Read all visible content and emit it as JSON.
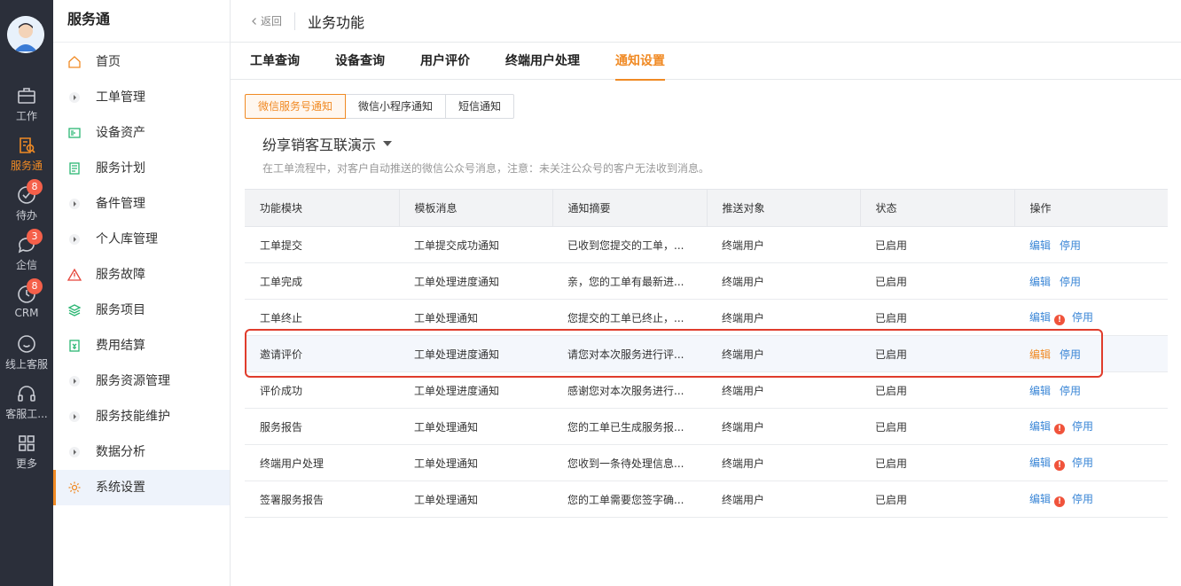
{
  "rail": {
    "items": [
      {
        "label": "工作",
        "icon": "briefcase-icon",
        "badge": ""
      },
      {
        "label": "服务通",
        "icon": "service-icon",
        "badge": ""
      },
      {
        "label": "待办",
        "icon": "check-circle-icon",
        "badge": "8"
      },
      {
        "label": "企信",
        "icon": "chat-icon",
        "badge": "3"
      },
      {
        "label": "CRM",
        "icon": "clock-icon",
        "badge": "8"
      },
      {
        "label": "线上客服",
        "icon": "smile-chat-icon",
        "badge": ""
      },
      {
        "label": "客服工...",
        "icon": "headset-icon",
        "badge": ""
      },
      {
        "label": "更多",
        "icon": "grid-icon",
        "badge": ""
      }
    ]
  },
  "sidebar": {
    "title": "服务通",
    "items": [
      {
        "label": "首页",
        "icon": "home-icon"
      },
      {
        "label": "工单管理",
        "icon": "caret-icon"
      },
      {
        "label": "设备资产",
        "icon": "device-icon"
      },
      {
        "label": "服务计划",
        "icon": "plan-icon"
      },
      {
        "label": "备件管理",
        "icon": "caret-icon"
      },
      {
        "label": "个人库管理",
        "icon": "caret-icon"
      },
      {
        "label": "服务故障",
        "icon": "warning-icon"
      },
      {
        "label": "服务项目",
        "icon": "layers-icon"
      },
      {
        "label": "费用结算",
        "icon": "bill-icon"
      },
      {
        "label": "服务资源管理",
        "icon": "caret-icon"
      },
      {
        "label": "服务技能维护",
        "icon": "caret-icon"
      },
      {
        "label": "数据分析",
        "icon": "caret-icon"
      },
      {
        "label": "系统设置",
        "icon": "gear-icon"
      }
    ]
  },
  "header": {
    "back_label": "返回",
    "title": "业务功能"
  },
  "tabs": [
    "工单查询",
    "设备查询",
    "用户评价",
    "终端用户处理",
    "通知设置"
  ],
  "segments": [
    "微信服务号通知",
    "微信小程序通知",
    "短信通知"
  ],
  "account": "纷享销客互联演示",
  "description": "在工单流程中，对客户自动推送的微信公众号消息，注意：未关注公众号的客户无法收到消息。",
  "table": {
    "columns": [
      "功能模块",
      "模板消息",
      "通知摘要",
      "推送对象",
      "状态",
      "操作"
    ],
    "edit_label": "编辑",
    "disable_label": "停用",
    "rows": [
      {
        "module": "工单提交",
        "template": "工单提交成功通知",
        "summary": "已收到您提交的工单，...",
        "target": "终端用户",
        "status": "已启用"
      },
      {
        "module": "工单完成",
        "template": "工单处理进度通知",
        "summary": "亲，您的工单有最新进...",
        "target": "终端用户",
        "status": "已启用"
      },
      {
        "module": "工单终止",
        "template": "工单处理通知",
        "summary": "您提交的工单已终止，...",
        "target": "终端用户",
        "status": "已启用"
      },
      {
        "module": "邀请评价",
        "template": "工单处理进度通知",
        "summary": "请您对本次服务进行评...",
        "target": "终端用户",
        "status": "已启用"
      },
      {
        "module": "评价成功",
        "template": "工单处理进度通知",
        "summary": "感谢您对本次服务进行...",
        "target": "终端用户",
        "status": "已启用"
      },
      {
        "module": "服务报告",
        "template": "工单处理通知",
        "summary": "您的工单已生成服务报...",
        "target": "终端用户",
        "status": "已启用"
      },
      {
        "module": "终端用户处理",
        "template": "工单处理通知",
        "summary": "您收到一条待处理信息...",
        "target": "终端用户",
        "status": "已启用"
      },
      {
        "module": "签署服务报告",
        "template": "工单处理通知",
        "summary": "您的工单需要您签字确...",
        "target": "终端用户",
        "status": "已启用"
      }
    ]
  },
  "colors": {
    "accent": "#f08a24",
    "link": "#3a86d6",
    "rail_bg": "#2b2f3a",
    "highlight_box": "#e03c2c"
  }
}
